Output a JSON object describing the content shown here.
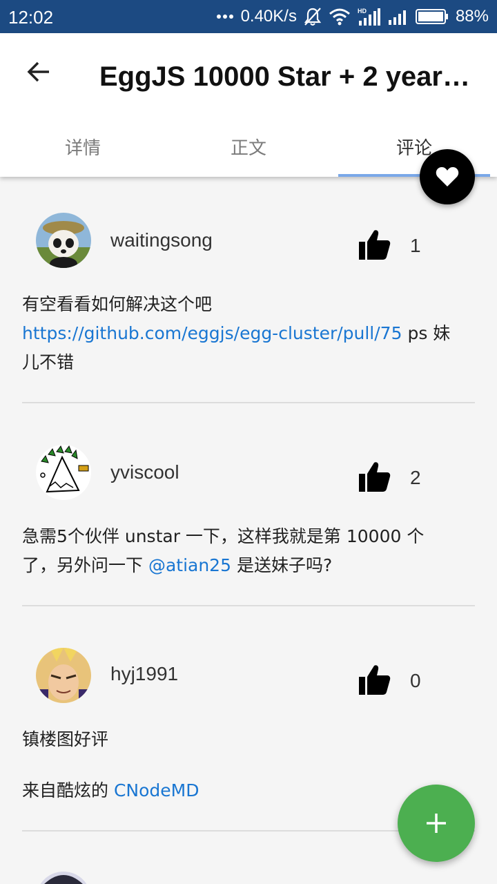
{
  "status_bar": {
    "time": "12:02",
    "speed": "0.40K/s",
    "battery": "88%",
    "icons": [
      "more-dots-icon",
      "bell-off-icon",
      "wifi-icon",
      "hd-signal-icon",
      "signal-icon",
      "battery-icon"
    ]
  },
  "app_bar": {
    "title": "EggJS 10000 Star + 2 years 的...",
    "back_icon": "arrow-back-icon",
    "tabs": [
      {
        "label": "详情",
        "active": false
      },
      {
        "label": "正文",
        "active": false
      },
      {
        "label": "评论",
        "active": true
      }
    ]
  },
  "fab_favorite": {
    "icon": "heart-icon"
  },
  "fab_add": {
    "icon": "plus-icon",
    "color": "#4caf50"
  },
  "comments": [
    {
      "username": "waitingsong",
      "likes": "1",
      "line1": "有空看看如何解决这个吧",
      "link": "https://github.com/eggjs/egg-cluster/pull/75",
      "after_link": " ps 妹",
      "line3": "儿不错"
    },
    {
      "username": "yviscool",
      "likes": "2",
      "line1": "急需5个伙伴 unstar 一下，这样我就是第 10000 个",
      "line2_before": "了，另外问一下 ",
      "mention": "@atian25",
      "line2_after": " 是送妹子吗?"
    },
    {
      "username": "hyj1991",
      "likes": "0",
      "line1": "镇楼图好评",
      "line2_before": "来自酷炫的 ",
      "link": "CNodeMD"
    }
  ],
  "colors": {
    "status_bar": "#1c4a82",
    "link": "#1976d2",
    "tab_indicator": "#7aa8e8",
    "fab_add": "#4caf50"
  }
}
